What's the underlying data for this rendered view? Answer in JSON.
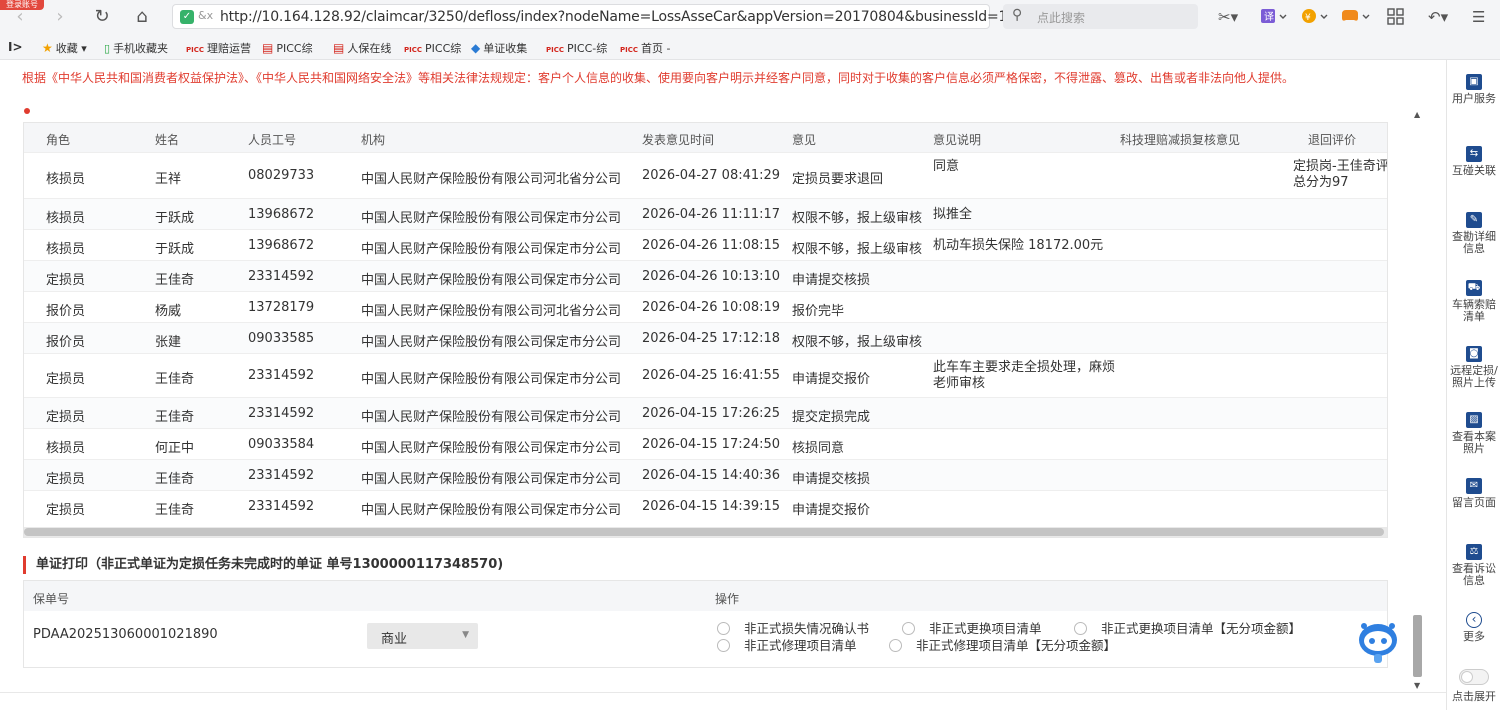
{
  "browser": {
    "corner_badge": "登录账号",
    "url": "http://10.164.128.92/claimcar/3250/defloss/index?nodeName=LossAsseCar&appVersion=20170804&businessId=1",
    "search_placeholder": "点此搜索"
  },
  "bookmarks": [
    {
      "icon": "★",
      "label": "收藏",
      "color": "#f2a100"
    },
    {
      "icon": "▯",
      "label": "手机收藏夹",
      "color": "#2aa845"
    },
    {
      "icon": "PICC",
      "label": "理赔运营",
      "color": "#d3251c"
    },
    {
      "icon": "▤",
      "label": "PICC综",
      "color": "#d3251c"
    },
    {
      "icon": "▤",
      "label": "人保在线",
      "color": "#d3251c"
    },
    {
      "icon": "PICC",
      "label": "PICC综",
      "color": "#d3251c"
    },
    {
      "icon": "◆",
      "label": "单证收集",
      "color": "#2a7bd4"
    },
    {
      "icon": "PICC",
      "label": "PICC-综",
      "color": "#d3251c"
    },
    {
      "icon": "PICC",
      "label": "首页 -",
      "color": "#d3251c"
    }
  ],
  "notice": "根据《中华人民共和国消费者权益保护法》、《中华人民共和国网络安全法》等相关法律法规规定：客户个人信息的收集、使用要向客户明示并经客户同意，同时对于收集的客户信息必须严格保密，不得泄露、篡改、出售或者非法向他人提供。",
  "opinion_table": {
    "headers": [
      "角色",
      "姓名",
      "人员工号",
      "机构",
      "发表意见时间",
      "意见",
      "意见说明",
      "科技理赔减损复核意见",
      "退回评价"
    ],
    "rows": [
      {
        "role": "核损员",
        "name": "王祥",
        "id": "08029733",
        "org": "中国人民财产保险股份有限公司河北省分公司",
        "time": "2026-04-27 08:41:29",
        "opinion": "定损员要求退回",
        "desc": "同意",
        "review": "",
        "eval": "定损岗-王佳奇评总分为97"
      },
      {
        "role": "核损员",
        "name": "于跃成",
        "id": "13968672",
        "org": "中国人民财产保险股份有限公司保定市分公司",
        "time": "2026-04-26 11:11:17",
        "opinion": "权限不够，报上级审核",
        "desc": "拟推全",
        "review": "",
        "eval": ""
      },
      {
        "role": "核损员",
        "name": "于跃成",
        "id": "13968672",
        "org": "中国人民财产保险股份有限公司保定市分公司",
        "time": "2026-04-26 11:08:15",
        "opinion": "权限不够，报上级审核",
        "desc": "机动车损失保险 18172.00元",
        "review": "",
        "eval": ""
      },
      {
        "role": "定损员",
        "name": "王佳奇",
        "id": "23314592",
        "org": "中国人民财产保险股份有限公司保定市分公司",
        "time": "2026-04-26 10:13:10",
        "opinion": "申请提交核损",
        "desc": "",
        "review": "",
        "eval": ""
      },
      {
        "role": "报价员",
        "name": "杨威",
        "id": "13728179",
        "org": "中国人民财产保险股份有限公司河北省分公司",
        "time": "2026-04-26 10:08:19",
        "opinion": "报价完毕",
        "desc": "",
        "review": "",
        "eval": ""
      },
      {
        "role": "报价员",
        "name": "张建",
        "id": "09033585",
        "org": "中国人民财产保险股份有限公司保定市分公司",
        "time": "2026-04-25 17:12:18",
        "opinion": "权限不够，报上级审核",
        "desc": "",
        "review": "",
        "eval": ""
      },
      {
        "role": "定损员",
        "name": "王佳奇",
        "id": "23314592",
        "org": "中国人民财产保险股份有限公司保定市分公司",
        "time": "2026-04-25 16:41:55",
        "opinion": "申请提交报价",
        "desc": "此车车主要求走全损处理，麻烦老师审核",
        "review": "",
        "eval": ""
      },
      {
        "role": "定损员",
        "name": "王佳奇",
        "id": "23314592",
        "org": "中国人民财产保险股份有限公司保定市分公司",
        "time": "2026-04-15 17:26:25",
        "opinion": "提交定损完成",
        "desc": "",
        "review": "",
        "eval": ""
      },
      {
        "role": "核损员",
        "name": "何正中",
        "id": "09033584",
        "org": "中国人民财产保险股份有限公司保定市分公司",
        "time": "2026-04-15 17:24:50",
        "opinion": "核损同意",
        "desc": "",
        "review": "",
        "eval": ""
      },
      {
        "role": "定损员",
        "name": "王佳奇",
        "id": "23314592",
        "org": "中国人民财产保险股份有限公司保定市分公司",
        "time": "2026-04-15 14:40:36",
        "opinion": "申请提交核损",
        "desc": "",
        "review": "",
        "eval": ""
      },
      {
        "role": "定损员",
        "name": "王佳奇",
        "id": "23314592",
        "org": "中国人民财产保险股份有限公司保定市分公司",
        "time": "2026-04-15 14:39:15",
        "opinion": "申请提交报价",
        "desc": "",
        "review": "",
        "eval": ""
      }
    ]
  },
  "doc_print": {
    "title": "单证打印（非正式单证为定损任务未完成时的单证 单号1300000117348570)",
    "col_policy": "保单号",
    "col_action": "操作",
    "policy_no": "PDAA202513060001021890",
    "select_value": "商业",
    "options": [
      "非正式损失情况确认书",
      "非正式更换项目清单",
      "非正式更换项目清单【无分项金额】",
      "非正式修理项目清单",
      "非正式修理项目清单【无分项金额】"
    ]
  },
  "side_panel": [
    {
      "label": "用户服务",
      "icon": "▣"
    },
    {
      "label": "互碰关联",
      "icon": "⇆"
    },
    {
      "label": "查勘详细信息",
      "icon": "✎"
    },
    {
      "label": "车辆索赔清单",
      "icon": "⛟"
    },
    {
      "label": "远程定损/照片上传",
      "icon": "◙"
    },
    {
      "label": "查看本案照片",
      "icon": "▨"
    },
    {
      "label": "留言页面",
      "icon": "✉"
    },
    {
      "label": "查看诉讼信息",
      "icon": "⚖"
    },
    {
      "label": "更多",
      "icon": "‹"
    }
  ],
  "toggle_label": "点击展开",
  "colors": {
    "notice_red": "#e03c2f",
    "side_icon_blue": "#1f4c8f",
    "header_bg": "#f5f6f8"
  }
}
